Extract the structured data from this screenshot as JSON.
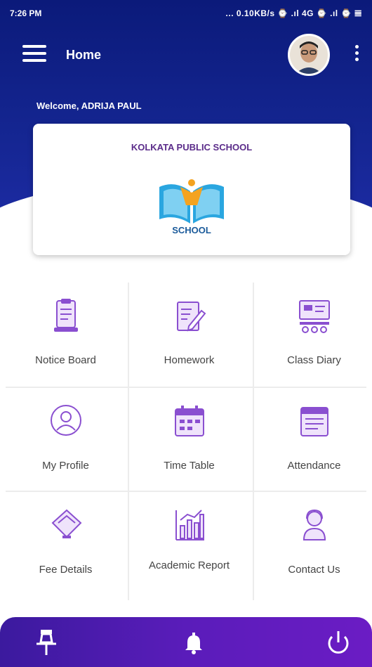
{
  "status_bar": {
    "time": "7:26 PM",
    "indicators": "... 0.10KB/s ⌚ .ıl 4G ⌚ .ıl ⌚ 𝌆"
  },
  "header": {
    "title": "Home",
    "welcome": "Welcome, ADRIJA PAUL"
  },
  "school": {
    "name": "KOLKATA PUBLIC SCHOOL",
    "logo_text": "SCHOOL"
  },
  "grid": {
    "items": [
      {
        "label": "Notice Board",
        "icon": "notice-board-icon"
      },
      {
        "label": "Homework",
        "icon": "homework-icon"
      },
      {
        "label": "Class Diary",
        "icon": "class-diary-icon"
      },
      {
        "label": "My Profile",
        "icon": "profile-icon"
      },
      {
        "label": "Time Table",
        "icon": "calendar-icon"
      },
      {
        "label": "Attendance",
        "icon": "attendance-icon"
      },
      {
        "label": "Fee Details",
        "icon": "card-icon"
      },
      {
        "label": "Academic Report",
        "icon": "chart-icon"
      },
      {
        "label": "Contact Us",
        "icon": "contact-icon"
      }
    ]
  },
  "bottom_bar": {
    "icons": [
      "pin-icon",
      "bell-icon",
      "power-icon"
    ]
  },
  "colors": {
    "header": "#142590",
    "accent": "#7b3fc4",
    "bottom_bar": "#5a1cba"
  }
}
